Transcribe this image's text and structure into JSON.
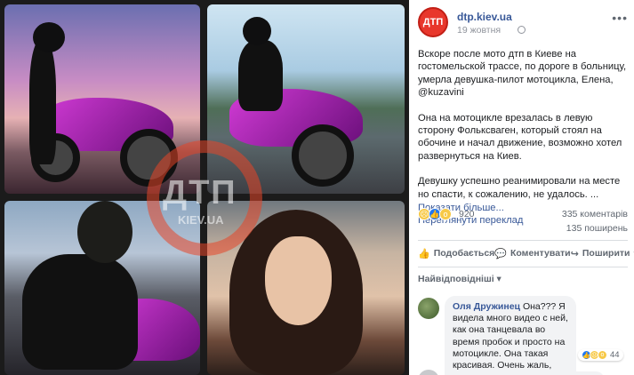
{
  "post": {
    "page_name": "dtp.kiev.ua",
    "avatar_text": "ДТП",
    "date": "19 жовтня",
    "more_icon": "more-horizontal-icon",
    "paragraphs": [
      "Вскоре после мото дтп в Киеве на гостомельской трассе, по дороге в больницу, умерла девушка-пилот мотоцикла, Елена, @kuzavini",
      "Она на мотоцикле врезалась в левую сторону Фольксваген, который стоял на обочине и начал движение, возможно хотел развернуться на Киев.",
      "Девушку успешно реанимировали на месте но спасти, к сожалению, не удалось. ..."
    ],
    "see_more": "Показати більше...",
    "translate": "Переглянути переклад"
  },
  "stats": {
    "reaction_icons": [
      "sad-icon",
      "like-icon",
      "wow-icon"
    ],
    "reaction_count": "920",
    "comments": "335 коментарів",
    "shares": "135 поширень"
  },
  "actions": {
    "like": "Подобається",
    "comment": "Коментувати",
    "share": "Поширити"
  },
  "comments_section": {
    "sort_label": "Найвідповідніші ▾",
    "comment": {
      "author": "Оля Дружинец",
      "text": "Она??? Я видела много видео с ней, как она танцевала во время пробок и просто на мотоцикле. Она такая красивая. Очень жаль, ужасно😢",
      "reaction_count": "44"
    }
  },
  "watermark": {
    "text": "ДТП",
    "sub": "KIEV.UA"
  },
  "colors": {
    "link": "#385898",
    "brand_red": "#e8372c",
    "motorcycle": "#d23bd6"
  }
}
